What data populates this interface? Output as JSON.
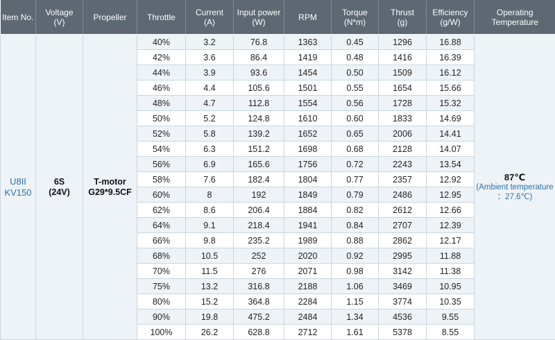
{
  "headers": [
    [
      "Item No."
    ],
    [
      "Voltage",
      "(V)"
    ],
    [
      "Propeller"
    ],
    [
      "Throttle"
    ],
    [
      "Current",
      "(A)"
    ],
    [
      "Input power",
      "(W)"
    ],
    [
      "RPM"
    ],
    [
      "Torque",
      "(N*m)"
    ],
    [
      "Thrust",
      "(g)"
    ],
    [
      "Efficiency",
      "(g/W)"
    ],
    [
      "Operating Temperature"
    ]
  ],
  "item_no": [
    "U8II",
    "KV150"
  ],
  "voltage": [
    "6S",
    "(24V)"
  ],
  "propeller": [
    "T-motor",
    "G29*9.5CF"
  ],
  "temperature": {
    "main": "87℃",
    "sub": [
      "(Ambient temperature",
      "：27.6℃)"
    ]
  },
  "rows": [
    [
      "40%",
      "3.2",
      "76.8",
      "1363",
      "0.45",
      "1296",
      "16.88"
    ],
    [
      "42%",
      "3.6",
      "86.4",
      "1419",
      "0.48",
      "1416",
      "16.39"
    ],
    [
      "44%",
      "3.9",
      "93.6",
      "1454",
      "0.50",
      "1509",
      "16.12"
    ],
    [
      "46%",
      "4.4",
      "105.6",
      "1501",
      "0.55",
      "1654",
      "15.66"
    ],
    [
      "48%",
      "4.7",
      "112.8",
      "1554",
      "0.56",
      "1728",
      "15.32"
    ],
    [
      "50%",
      "5.2",
      "124.8",
      "1610",
      "0.60",
      "1833",
      "14.69"
    ],
    [
      "52%",
      "5.8",
      "139.2",
      "1652",
      "0.65",
      "2006",
      "14.41"
    ],
    [
      "54%",
      "6.3",
      "151.2",
      "1698",
      "0.68",
      "2128",
      "14.07"
    ],
    [
      "56%",
      "6.9",
      "165.6",
      "1756",
      "0.72",
      "2243",
      "13.54"
    ],
    [
      "58%",
      "7.6",
      "182.4",
      "1804",
      "0.77",
      "2357",
      "12.92"
    ],
    [
      "60%",
      "8",
      "192",
      "1849",
      "0.79",
      "2486",
      "12.95"
    ],
    [
      "62%",
      "8.6",
      "206.4",
      "1884",
      "0.82",
      "2612",
      "12.66"
    ],
    [
      "64%",
      "9.1",
      "218.4",
      "1941",
      "0.84",
      "2707",
      "12.39"
    ],
    [
      "66%",
      "9.8",
      "235.2",
      "1989",
      "0.88",
      "2862",
      "12.17"
    ],
    [
      "68%",
      "10.5",
      "252",
      "2020",
      "0.92",
      "2995",
      "11.88"
    ],
    [
      "70%",
      "11.5",
      "276",
      "2071",
      "0.98",
      "3142",
      "11.38"
    ],
    [
      "75%",
      "13.2",
      "316.8",
      "2188",
      "1.06",
      "3469",
      "10.95"
    ],
    [
      "80%",
      "15.2",
      "364.8",
      "2284",
      "1.15",
      "3774",
      "10.35"
    ],
    [
      "90%",
      "19.8",
      "475.2",
      "2484",
      "1.34",
      "4536",
      "9.55"
    ],
    [
      "100%",
      "26.2",
      "628.8",
      "2712",
      "1.61",
      "5378",
      "8.55"
    ]
  ]
}
